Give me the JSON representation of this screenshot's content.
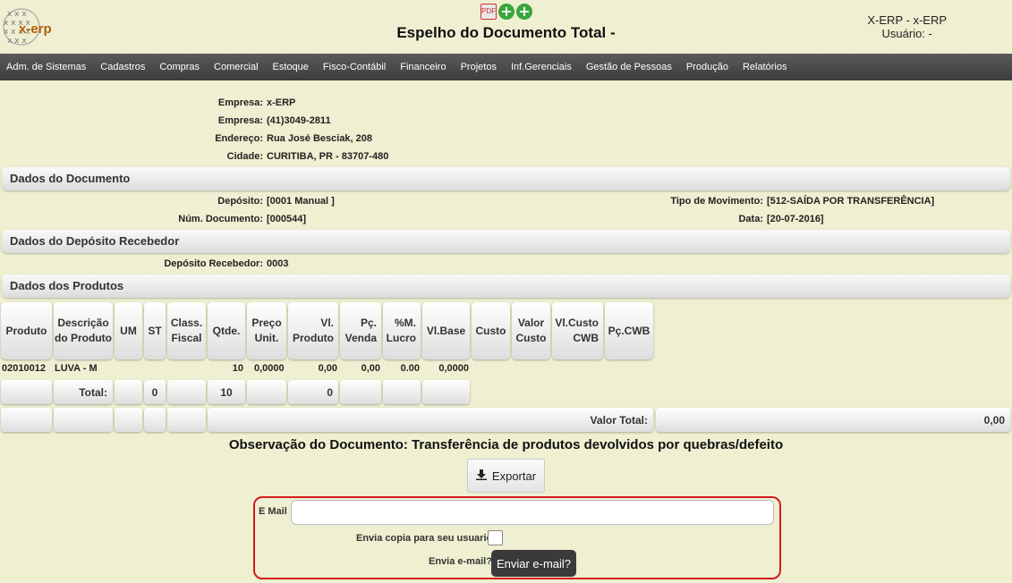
{
  "header": {
    "logo_text": "x-erp",
    "pdf_icon_text": "PDF",
    "title": "Espelho do Documento Total -",
    "user_line1": "X-ERP - x-ERP",
    "user_line2": "Usuário: -"
  },
  "menu": [
    "Adm. de Sistemas",
    "Cadastros",
    "Compras",
    "Comercial",
    "Estoque",
    "Fisco-Contábil",
    "Financeiro",
    "Projetos",
    "Inf.Gerenciais",
    "Gestão de Pessoas",
    "Produção",
    "Relatórios"
  ],
  "company": [
    {
      "label": "Empresa:",
      "value": "x-ERP"
    },
    {
      "label": "Empresa:",
      "value": "(41)3049-2811"
    },
    {
      "label": "Endereço:",
      "value": "Rua José Besciak, 208"
    },
    {
      "label": "Cidade:",
      "value": "CURITIBA, PR - 83707-480"
    }
  ],
  "sections": {
    "documento": "Dados do Documento",
    "deposito": "Dados do Depósito Recebedor",
    "produtos": "Dados dos Produtos"
  },
  "documento": {
    "deposito_label": "Depósito:",
    "deposito_value": "[0001 Manual ]",
    "numero_label": "Núm. Documento:",
    "numero_value": "[000544]",
    "tipo_label": "Tipo de Movimento:",
    "tipo_value": "[512-SAÍDA POR TRANSFERÊNCIA]",
    "data_label": "Data:",
    "data_value": "[20-07-2016]"
  },
  "deposito_recebedor": {
    "label": "Depósito Recebedor:",
    "value": "0003"
  },
  "table": {
    "headers": [
      "Produto",
      "Descrição do Produto",
      "UM",
      "ST",
      "Class. Fiscal",
      "Qtde.",
      "Preço Unit.",
      "Vl. Produto",
      "Pç. Venda",
      "%M. Lucro",
      "Vl.Base",
      "Custo",
      "Valor Custo",
      "Vl.Custo CWB",
      "Pç.CWB"
    ],
    "row": {
      "produto": "02010012",
      "descricao": "LUVA - M",
      "qtde": "10",
      "preco": "0,0000",
      "vl_produto": "0,00",
      "pc_venda": "0,00",
      "m_lucro": "0.00",
      "vl_base": "0,0000"
    },
    "total_label": "Total:",
    "total_st": "0",
    "total_qtde": "10",
    "total_vl_produto": "0",
    "valor_total_label": "Valor Total:",
    "valor_total": "0,00"
  },
  "observacao": "Observação do Documento:  Transferência de produtos devolvidos por quebras/defeito",
  "export_label": "Exportar",
  "email": {
    "label": "E Mail",
    "value": "",
    "copy_label": "Envia copia para seu usuario?",
    "send_label": "Envia e-mail?",
    "send_button": "Enviar e-mail?"
  }
}
